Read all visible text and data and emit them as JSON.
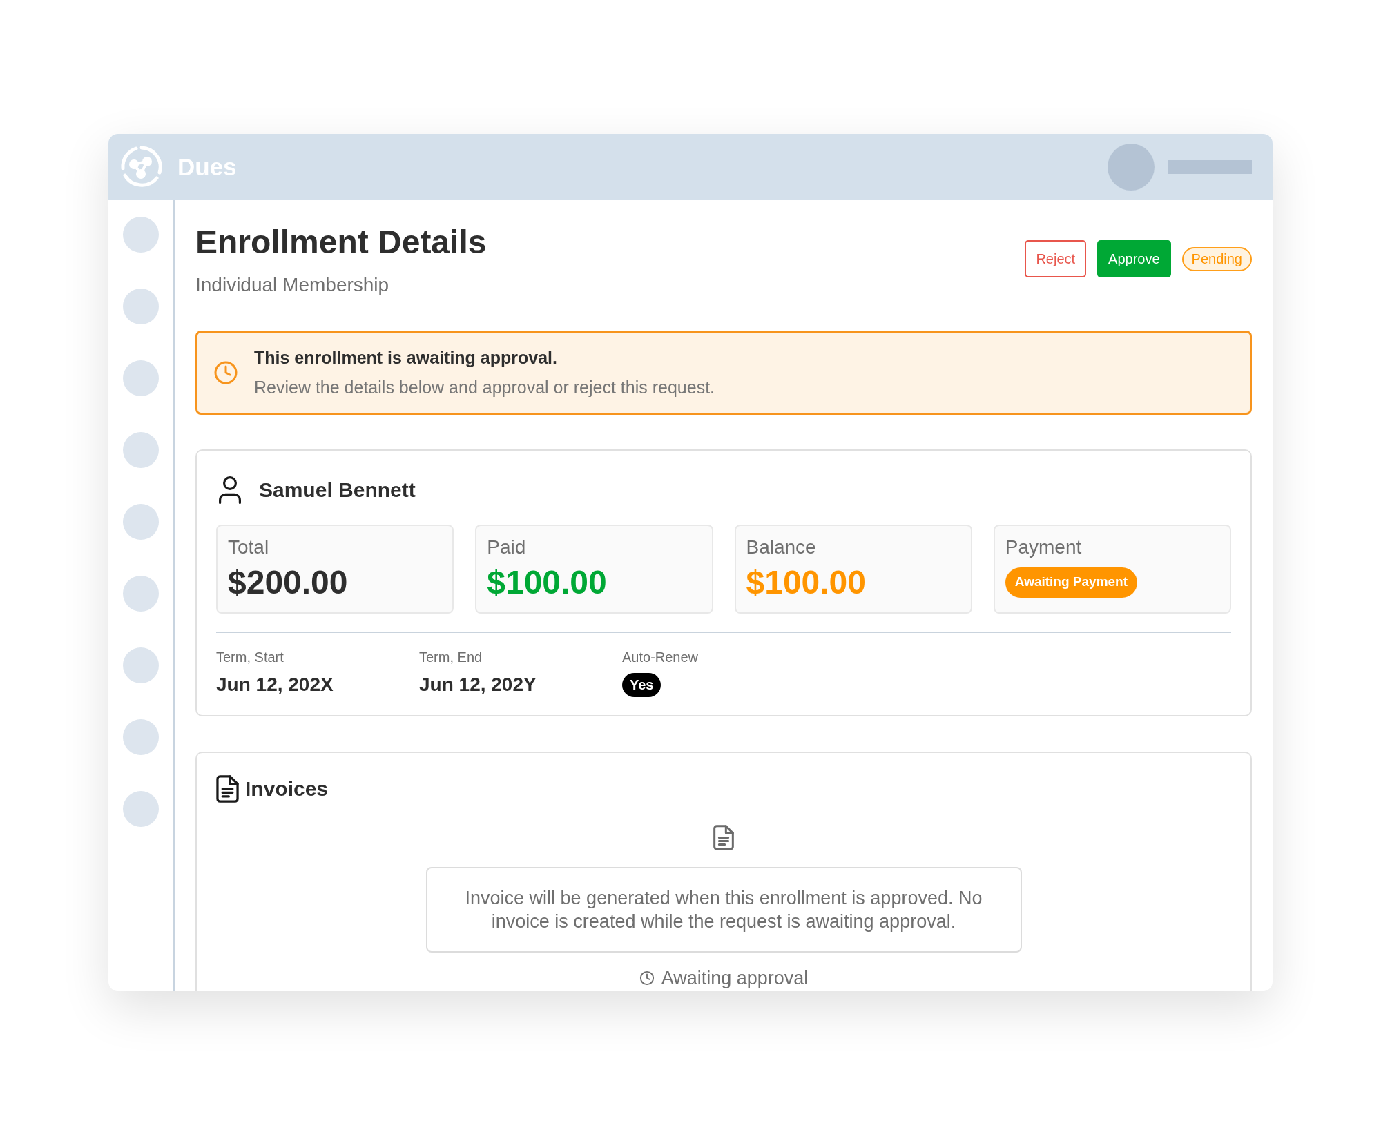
{
  "app": {
    "name": "Dues"
  },
  "page": {
    "title": "Enrollment Details",
    "subtitle": "Individual Membership",
    "actions": [
      {
        "label": "Reject",
        "kind": "reject"
      },
      {
        "label": "Approve",
        "kind": "approve"
      }
    ],
    "status": "Pending"
  },
  "alert": {
    "title": "This enrollment is awaiting approval.",
    "message": "Review the details below and approval or reject this request."
  },
  "member": {
    "name": "Samuel Bennett",
    "stats": [
      {
        "kind": "amount",
        "label": "Total",
        "value": "$200.00",
        "color": "#2e2e2e"
      },
      {
        "kind": "amount",
        "label": "Paid",
        "value": "$100.00",
        "color": "#00a835"
      },
      {
        "kind": "amount",
        "label": "Balance",
        "value": "$100.00",
        "color": "#ff9500"
      },
      {
        "kind": "badge",
        "label": "Payment",
        "value": "Awaiting Payment",
        "color": "#ff9500"
      }
    ],
    "terms": [
      {
        "kind": "text",
        "label": "Term, Start",
        "value": "Jun 12, 202X"
      },
      {
        "kind": "text",
        "label": "Term, End",
        "value": "Jun 12, 202Y"
      },
      {
        "kind": "badge",
        "label": "Auto-Renew",
        "value": "Yes"
      }
    ]
  },
  "invoices": {
    "title": "Invoices",
    "empty_message": "Invoice will be generated when this enrollment is approved. No invoice is created while the request is awaiting approval.",
    "status": "Awaiting approval"
  }
}
